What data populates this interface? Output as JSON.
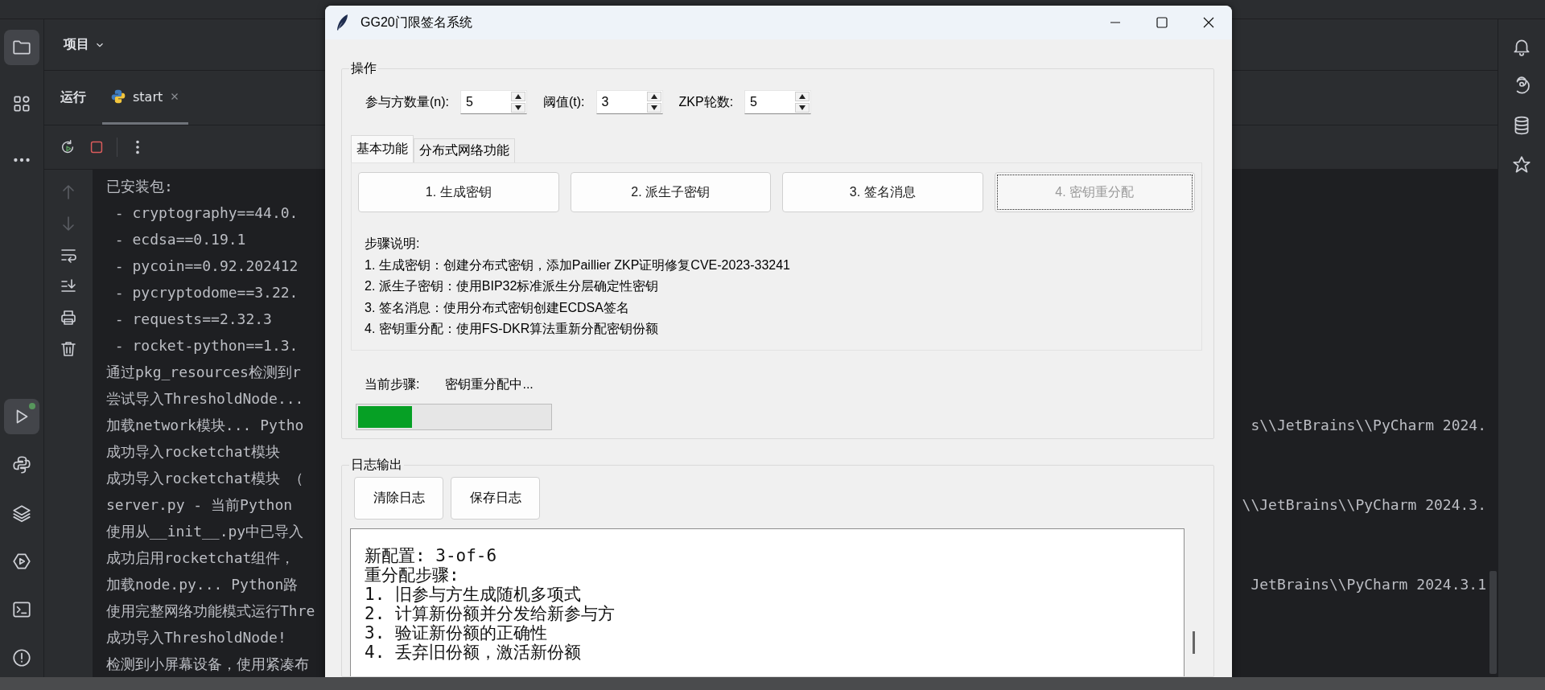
{
  "ide": {
    "project_label": "项目",
    "run_panel": {
      "title": "运行",
      "tabs": [
        {
          "label": "start",
          "selected": true
        }
      ],
      "console_lines": [
        {
          "text": "已安装包:"
        },
        {
          "text": " - cryptography==44.0."
        },
        {
          "text": " - ecdsa==0.19.1"
        },
        {
          "text": " - pycoin==0.92.202412"
        },
        {
          "text": " - pycryptodome==3.22."
        },
        {
          "text": " - requests==2.32.3"
        },
        {
          "text": " - rocket-python==1.3."
        },
        {
          "text": "通过pkg_resources检测到r"
        },
        {
          "text": "尝试导入ThresholdNode..."
        },
        {
          "text": "加载network模块... Pytho",
          "tail": "s\\\\JetBrains\\\\PyCharm 2024."
        },
        {
          "text": "成功导入rocketchat模块"
        },
        {
          "text": "成功导入rocketchat模块 （"
        },
        {
          "text": "server.py - 当前Python",
          "tail": "\\\\JetBrains\\\\PyCharm 2024.3."
        },
        {
          "text": "使用从__init__.py中已导入"
        },
        {
          "text": "成功启用rocketchat组件，"
        },
        {
          "text": "加载node.py... Python路",
          "tail": "JetBrains\\\\PyCharm 2024.3.1"
        },
        {
          "text": "使用完整网络功能模式运行Thre"
        },
        {
          "text": "成功导入ThresholdNode!"
        },
        {
          "text": "检测到小屏幕设备，使用紧凑布"
        }
      ]
    }
  },
  "dialog": {
    "title": "GG20门限签名系统",
    "operations": {
      "legend": "操作",
      "params": [
        {
          "label": "参与方数量(n):",
          "value": "5"
        },
        {
          "label": "阈值(t):",
          "value": "3"
        },
        {
          "label": "ZKP轮数:",
          "value": "5"
        }
      ],
      "tabs": [
        {
          "label": "基本功能",
          "selected": true
        },
        {
          "label": "分布式网络功能",
          "selected": false
        }
      ],
      "buttons": [
        {
          "label": "1. 生成密钥",
          "disabled": false,
          "focused": false
        },
        {
          "label": "2. 派生子密钥",
          "disabled": false,
          "focused": false
        },
        {
          "label": "3. 签名消息",
          "disabled": false,
          "focused": false
        },
        {
          "label": "4. 密钥重分配",
          "disabled": true,
          "focused": true
        }
      ],
      "steps_title": "步骤说明:",
      "steps": [
        "1. 生成密钥：创建分布式密钥，添加Paillier ZKP证明修复CVE-2023-33241",
        "2. 派生子密钥：使用BIP32标准派生分层确定性密钥",
        "3. 签名消息：使用分布式密钥创建ECDSA签名",
        "4. 密钥重分配：使用FS-DKR算法重新分配密钥份额"
      ],
      "status_label": "当前步骤:",
      "status_value": "密钥重分配中...",
      "progress": {
        "level": 0.28
      }
    },
    "log": {
      "legend": "日志输出",
      "buttons": [
        "清除日志",
        "保存日志"
      ],
      "lines": [
        "新配置: 3-of-6",
        "重分配步骤:",
        "1. 旧参与方生成随机多项式",
        "2. 计算新份额并分发给新参与方",
        "3. 验证新份额的正确性",
        "4. 丢弃旧份额，激活新份额"
      ]
    }
  }
}
